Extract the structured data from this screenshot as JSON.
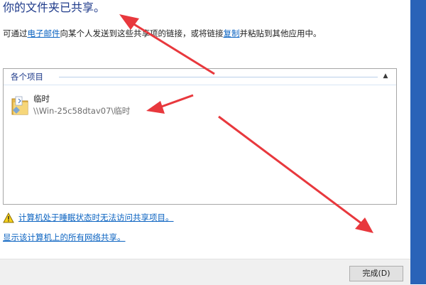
{
  "dialog": {
    "heading": "你的文件夹已共享。",
    "intro": {
      "before": "可通过",
      "email_link": "电子邮件",
      "middle": "向某个人发送到这些共享项的链接，或将链接",
      "copy_link": "复制",
      "after": "并粘贴到其他应用中。"
    },
    "items_group": {
      "label": "各个项目",
      "collapse_icon": "chevron-up-icon",
      "items": [
        {
          "name": "临时",
          "path": "\\\\Win-25c58dtav07\\临时",
          "icon": "folder-icon"
        }
      ]
    },
    "warning_link": "计算机处于睡眠状态时无法访问共享项目。",
    "show_all_link": "显示该计算机上的所有网络共享。",
    "finish_button": "完成(D)"
  },
  "colors": {
    "annotation_arrow": "#e8383d",
    "link": "#0b63c1",
    "heading": "#1e3a8a",
    "desktop_strip": "#2a63b8"
  }
}
